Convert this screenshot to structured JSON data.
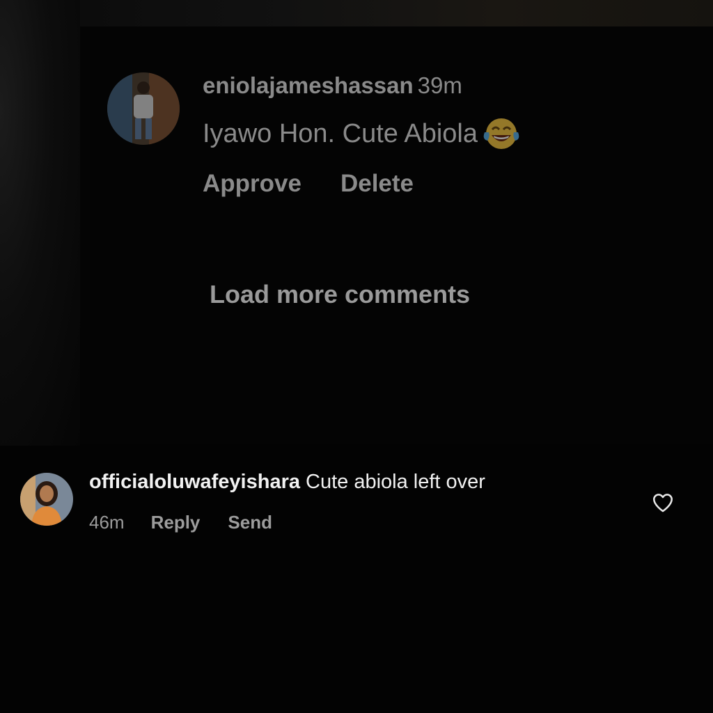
{
  "pending_comment": {
    "username": "eniolajameshassan",
    "time": "39m",
    "text": "Iyawo Hon. Cute Abiola",
    "emoji": "face-with-tears-of-joy-icon",
    "approve_label": "Approve",
    "delete_label": "Delete"
  },
  "load_more_label": "Load more comments",
  "comment": {
    "username": "officialoluwafeyishara",
    "text": "Cute abiola left over",
    "time": "46m",
    "reply_label": "Reply",
    "send_label": "Send",
    "like_icon": "heart-outline-icon"
  },
  "colors": {
    "background": "#030303",
    "primary_text": "#f2f2f2",
    "secondary_text": "#9c9c9c",
    "dimmed_text": "#8a8a8a"
  }
}
